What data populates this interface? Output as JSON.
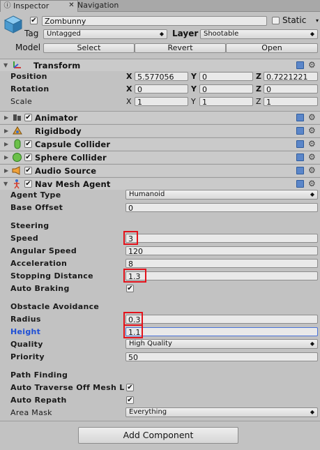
{
  "tabs": [
    {
      "label": "Inspector",
      "icon": "info-icon"
    },
    {
      "label": "Navigation",
      "icon": "navigation-icon"
    }
  ],
  "object": {
    "name": "Zombunny",
    "active": true,
    "static_label": "Static",
    "static_checked": false,
    "tag_label": "Tag",
    "tag_value": "Untagged",
    "layer_label": "Layer",
    "layer_value": "Shootable",
    "model_label": "Model",
    "model_buttons": [
      "Select",
      "Revert",
      "Open"
    ]
  },
  "transform": {
    "title": "Transform",
    "rows": [
      {
        "label": "Position",
        "x": "5.577056",
        "y": "0",
        "z": "0.7221221"
      },
      {
        "label": "Rotation",
        "x": "0",
        "y": "0",
        "z": "0"
      },
      {
        "label": "Scale",
        "x": "1",
        "y": "1",
        "z": "1"
      }
    ],
    "axis": [
      "X",
      "Y",
      "Z"
    ]
  },
  "components": [
    {
      "label": "Animator",
      "checkbox": true,
      "icon": "animator-icon"
    },
    {
      "label": "Rigidbody",
      "checkbox": false,
      "icon": "rigidbody-icon"
    },
    {
      "label": "Capsule Collider",
      "checkbox": true,
      "icon": "capsule-collider-icon"
    },
    {
      "label": "Sphere Collider",
      "checkbox": true,
      "icon": "sphere-collider-icon"
    },
    {
      "label": "Audio Source",
      "checkbox": true,
      "icon": "audio-source-icon"
    }
  ],
  "nav_agent": {
    "title": "Nav Mesh Agent",
    "agent_type_label": "Agent Type",
    "agent_type_value": "Humanoid",
    "base_offset_label": "Base Offset",
    "base_offset_value": "0",
    "steering_header": "Steering",
    "speed_label": "Speed",
    "speed_value": "3",
    "angular_speed_label": "Angular Speed",
    "angular_speed_value": "120",
    "acceleration_label": "Acceleration",
    "acceleration_value": "8",
    "stopping_distance_label": "Stopping Distance",
    "stopping_distance_value": "1.3",
    "auto_braking_label": "Auto Braking",
    "obstacle_header": "Obstacle Avoidance",
    "radius_label": "Radius",
    "radius_value": "0.3",
    "height_label": "Height",
    "height_value": "1.1",
    "quality_label": "Quality",
    "quality_value": "High Quality",
    "priority_label": "Priority",
    "priority_value": "50",
    "pathfinding_header": "Path Finding",
    "auto_traverse_label": "Auto Traverse Off Mesh L",
    "auto_repath_label": "Auto Repath",
    "area_mask_label": "Area Mask",
    "area_mask_value": "Everything"
  },
  "add_component_label": "Add Component",
  "highlight_color": "#e3121b"
}
